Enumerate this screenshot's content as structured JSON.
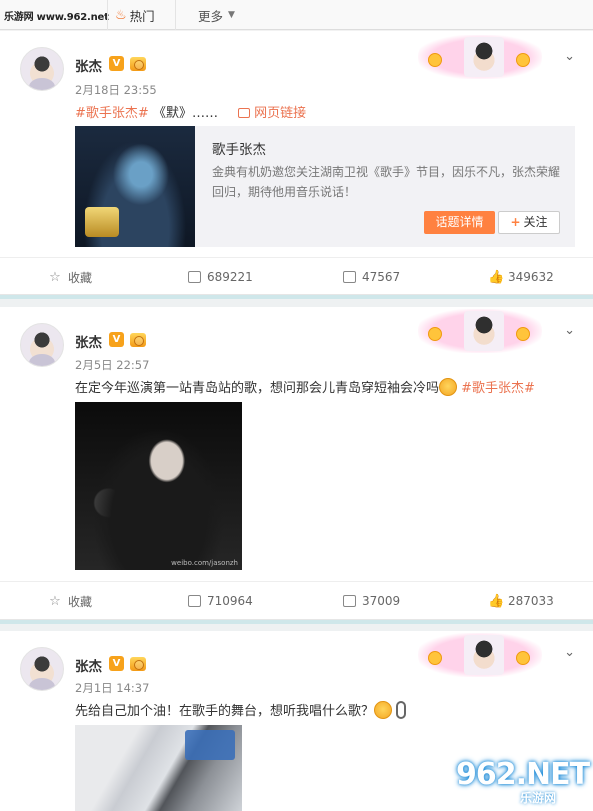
{
  "watermark": {
    "top_left": "乐游网 www.962.net",
    "bottom_right_big": "962.NET",
    "bottom_right_small": "乐游网"
  },
  "tabs": {
    "hot": "热门",
    "more": "更多"
  },
  "posts": [
    {
      "user": "张杰",
      "verified_badge": "V",
      "time": "2月18日 23:55",
      "hashtag": "#歌手张杰#",
      "text": "《默》……",
      "link_text": "网页链接",
      "topic": {
        "title": "歌手张杰",
        "description": "金典有机奶邀您关注湖南卫视《歌手》节目，因乐不凡，张杰荣耀回归，期待他用音乐说话！",
        "detail_button": "话题详情",
        "follow_button": "关注"
      },
      "actions": {
        "favorite": "收藏",
        "forward": "689221",
        "comment": "47567",
        "like": "349632"
      }
    },
    {
      "user": "张杰",
      "verified_badge": "V",
      "time": "2月5日 22:57",
      "text": "在定今年巡演第一站青岛站的歌，想问那会儿青岛穿短袖会冷吗",
      "hashtag": "#歌手张杰#",
      "image_caption": "weibo.com/jasonzh",
      "actions": {
        "favorite": "收藏",
        "forward": "710964",
        "comment": "37009",
        "like": "287033"
      }
    },
    {
      "user": "张杰",
      "verified_badge": "V",
      "time": "2月1日 14:37",
      "text": "先给自己加个油！在歌手的舞台，想听我唱什么歌？"
    }
  ],
  "icons": {
    "hot": "flame-icon",
    "more": "chevron-down-icon",
    "favorite": "star-icon",
    "forward": "forward-icon",
    "comment": "comment-icon",
    "like": "thumbs-up-icon",
    "menu": "chevron-down-icon"
  },
  "colors": {
    "accent": "#eb7350",
    "button": "#ff8140",
    "separator": "#cfe7ea"
  }
}
